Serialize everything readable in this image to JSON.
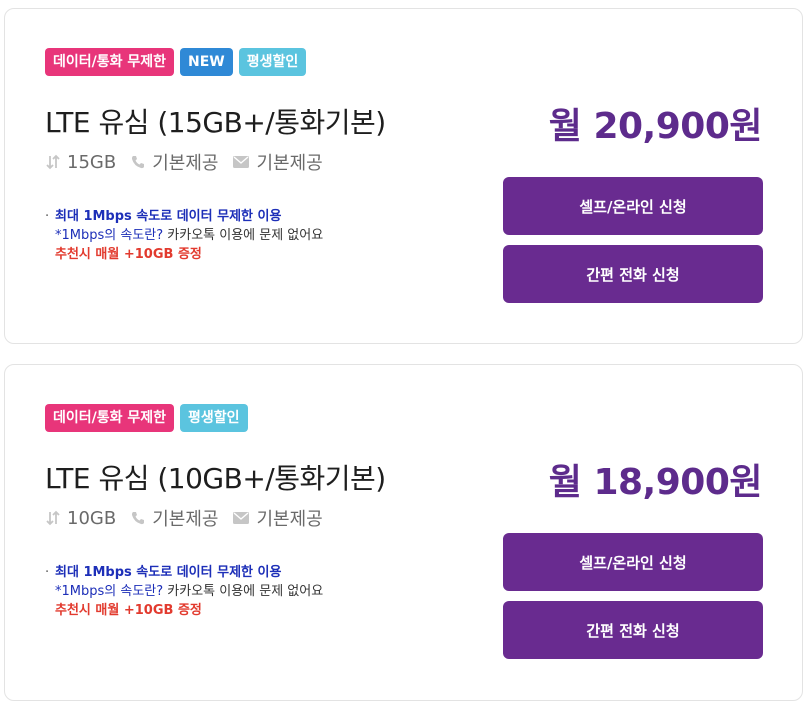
{
  "plans": [
    {
      "badges": [
        "데이터/통화 무제한",
        "NEW",
        "평생할인"
      ],
      "title": "LTE 유심 (15GB+/통화기본)",
      "price": "월 20,900원",
      "data": "15GB",
      "call": "기본제공",
      "sms": "기본제공",
      "note_main": "최대 1Mbps 속도로 데이터 무제한 이용",
      "note_sub_blue": "*1Mbps의 속도란?",
      "note_sub_rest": " 카카오톡 이용에 문제 없어요",
      "note_red": "추천시 매월 +10GB 증정",
      "btn_online": "셀프/온라인 신청",
      "btn_phone": "간편 전화 신청"
    },
    {
      "badges": [
        "데이터/통화 무제한",
        "평생할인"
      ],
      "title": "LTE 유심 (10GB+/통화기본)",
      "price": "월 18,900원",
      "data": "10GB",
      "call": "기본제공",
      "sms": "기본제공",
      "note_main": "최대 1Mbps 속도로 데이터 무제한 이용",
      "note_sub_blue": "*1Mbps의 속도란?",
      "note_sub_rest": " 카카오톡 이용에 문제 없어요",
      "note_red": "추천시 매월 +10GB 증정",
      "btn_online": "셀프/온라인 신청",
      "btn_phone": "간편 전화 신청"
    }
  ],
  "colors": {
    "badge_pink": "#e8357a",
    "badge_blue": "#2f89d6",
    "badge_cyan": "#5bc4df",
    "price": "#5d2b8c",
    "button": "#692b90",
    "note_blue": "#1d2fb8",
    "note_red": "#e23a2e"
  },
  "icons": {
    "data": "data-arrows-icon",
    "call": "phone-icon",
    "sms": "envelope-icon"
  }
}
